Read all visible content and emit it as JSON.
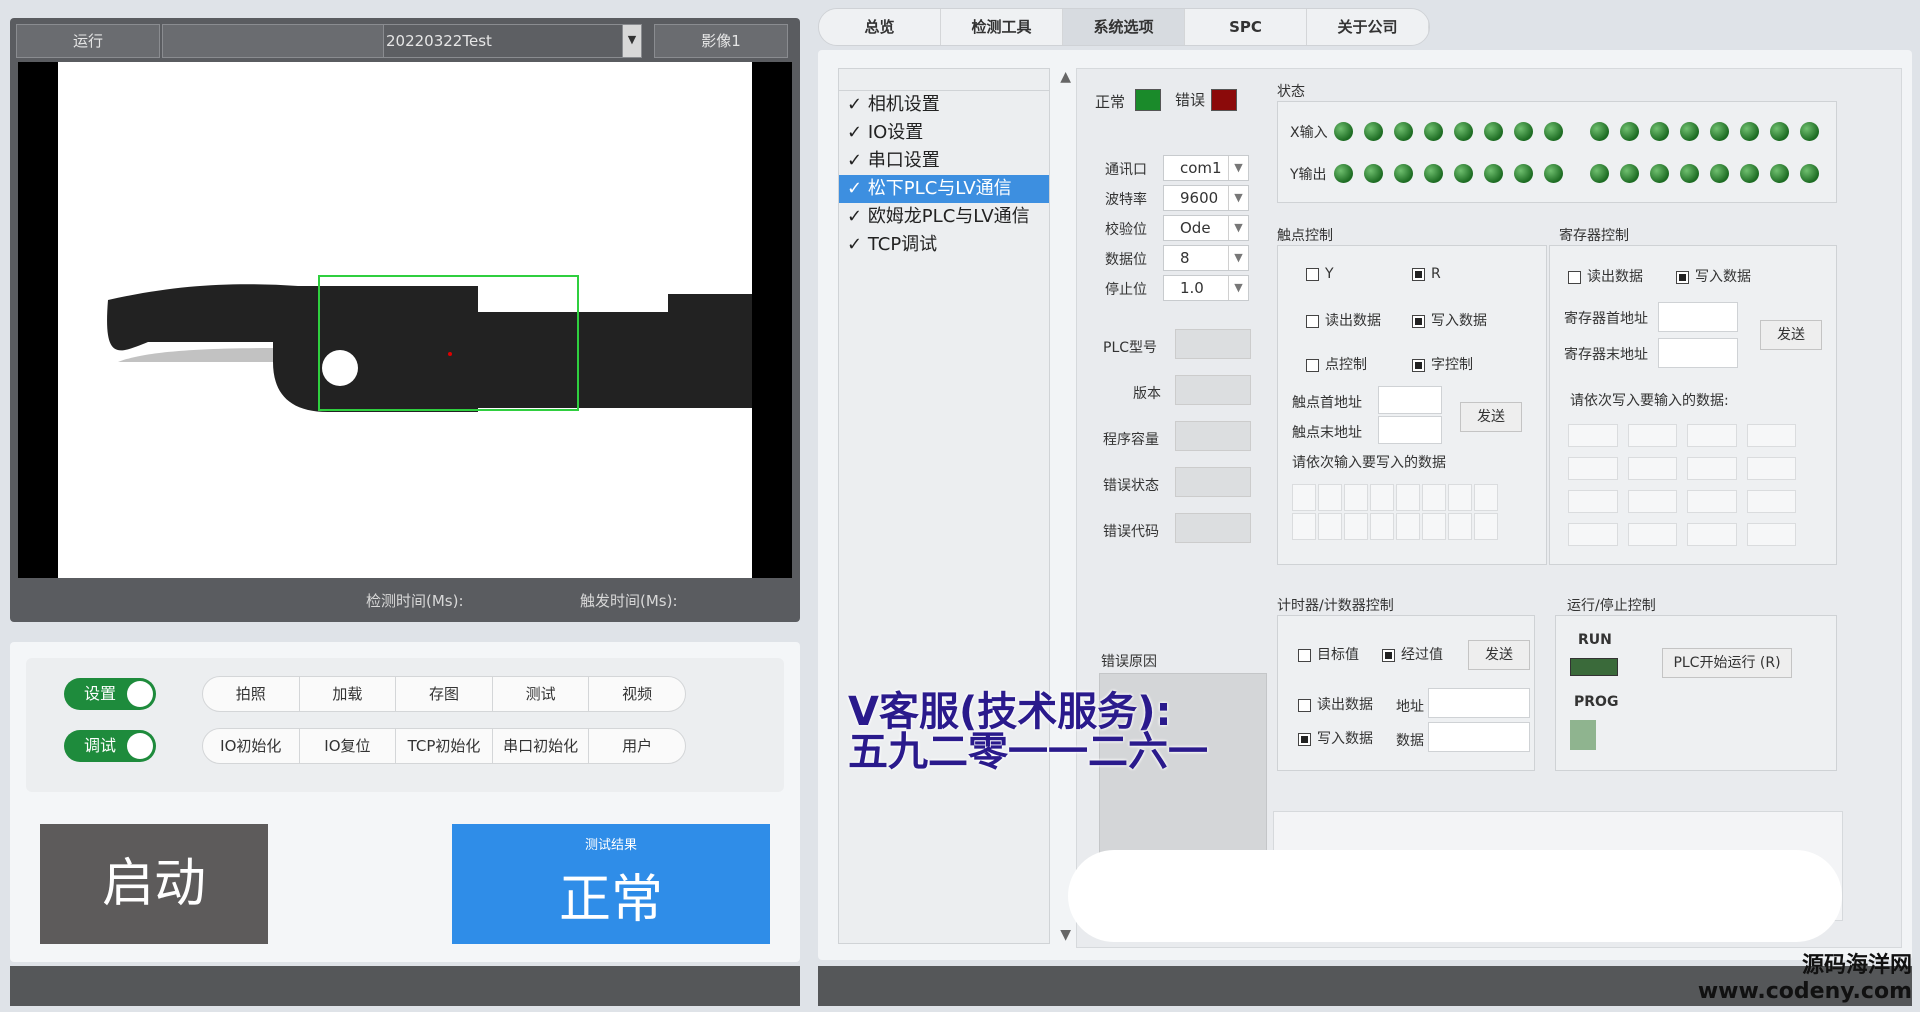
{
  "left": {
    "header": {
      "mode": "运行",
      "recipe": "20220322Test",
      "image_select": "影像1"
    },
    "time_labels": {
      "detect": "检测时间(Ms):",
      "trigger": "触发时间(Ms):"
    },
    "toggles": {
      "setup": "设置",
      "debug": "调试"
    },
    "row1": [
      "拍照",
      "加载",
      "存图",
      "测试",
      "视频"
    ],
    "row2": [
      "IO初始化",
      "IO复位",
      "TCP初始化",
      "串口初始化",
      "用户"
    ],
    "start": "启动",
    "result_caption": "测试结果",
    "result_value": "正常"
  },
  "tabs": [
    "总览",
    "检测工具",
    "系统选项",
    "SPC",
    "关于公司"
  ],
  "nav": [
    "相机设置",
    "IO设置",
    "串口设置",
    "松下PLC与LV通信",
    "欧姆龙PLC与LV通信",
    "TCP调试"
  ],
  "status": {
    "normal": "正常",
    "error": "错误",
    "normal_color": "#1a8a2a",
    "error_color": "#8b0a0a"
  },
  "serial": {
    "labels": [
      "通讯口",
      "波特率",
      "校验位",
      "数据位",
      "停止位"
    ],
    "values": [
      "com1",
      "9600",
      "Ode",
      "8",
      "1.0"
    ]
  },
  "plc_info": [
    "PLC型号",
    "版本",
    "程序容量",
    "错误状态",
    "错误代码"
  ],
  "error_reason": "错误原因",
  "state": {
    "title": "状态",
    "x": "X输入",
    "y": "Y输出"
  },
  "contact": {
    "title": "触点控制",
    "y": "Y",
    "r": "R",
    "read": "读出数据",
    "write": "写入数据",
    "point": "点控制",
    "word": "字控制",
    "start_addr": "触点首地址",
    "end_addr": "触点末地址",
    "send": "发送",
    "hint": "请依次输入要写入的数据"
  },
  "register": {
    "title": "寄存器控制",
    "read": "读出数据",
    "write": "写入数据",
    "start_addr": "寄存器首地址",
    "end_addr": "寄存器末地址",
    "send": "发送",
    "hint": "请依次写入要输入的数据:"
  },
  "timer": {
    "title": "计时器/计数器控制",
    "target": "目标值",
    "elapsed": "经过值",
    "send": "发送",
    "read": "读出数据",
    "write": "写入数据",
    "addr": "地址",
    "data": "数据"
  },
  "runstop": {
    "title": "运行/停止控制",
    "run": "RUN",
    "prog": "PROG",
    "start_btn": "PLC开始运行 (R)"
  },
  "overlay": {
    "line1": "V客服(技术服务):",
    "line2": "五九二零一一二六一"
  },
  "watermark": {
    "line1": "源码海洋网",
    "line2": "www.codeny.com"
  }
}
